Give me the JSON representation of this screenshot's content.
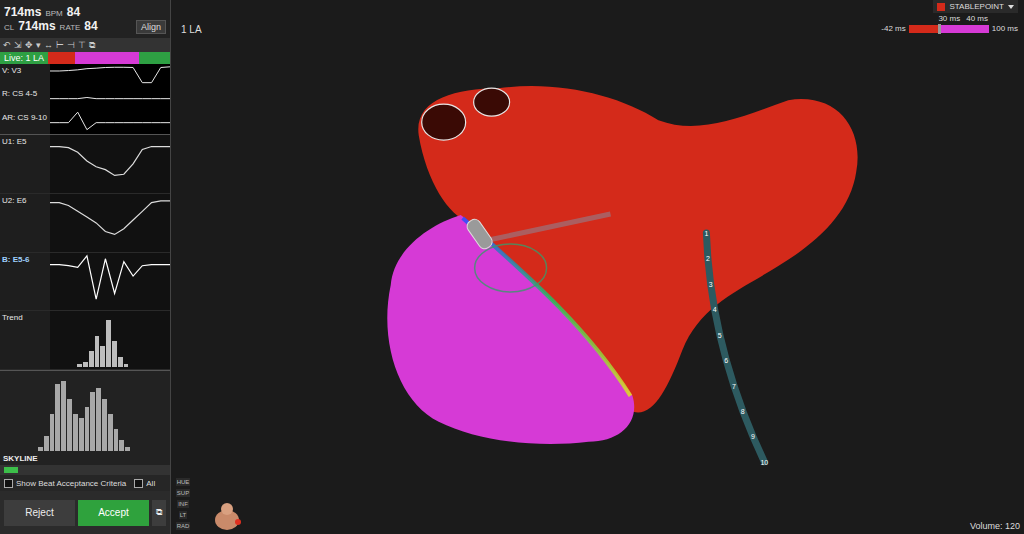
{
  "header": {
    "cl_top": "714ms",
    "bpm_label": "BPM",
    "bpm_top": "84",
    "cl_label": "CL",
    "cl": "714ms",
    "rate_label": "RATE",
    "rate": "84",
    "align": "Align"
  },
  "toolbar": [
    "↶",
    "⇲",
    "✥",
    "▾",
    "↔",
    "⊢",
    "⊣",
    "⊤",
    "⧉"
  ],
  "live": {
    "label": "Live: 1 LA",
    "segments": [
      {
        "color": "#2ea043",
        "level": 0.28
      },
      {
        "color": "#d42a1a",
        "level": 0.16
      },
      {
        "color": "#d63ad6",
        "level": 0.38
      },
      {
        "color": "#2ea043",
        "level": 0.18
      }
    ]
  },
  "reference": [
    {
      "label": "V: V3",
      "values": [
        0.7,
        0.7,
        0.72,
        0.75,
        0.8,
        0.82,
        0.85,
        0.86,
        0.86,
        0.85,
        0.2,
        0.2,
        0.85,
        0.88
      ]
    },
    {
      "label": "R: CS 4-5",
      "values": [
        0.5,
        0.5,
        0.5,
        0.5,
        0.55,
        0.5,
        0.5,
        0.5,
        0.5,
        0.5,
        0.5,
        0.5,
        0.5,
        0.5
      ]
    },
    {
      "label": "AR: CS 9-10",
      "values": [
        0.5,
        0.5,
        0.5,
        0.95,
        0.2,
        0.5,
        0.5,
        0.5,
        0.5,
        0.5,
        0.5,
        0.5,
        0.5,
        0.5
      ]
    }
  ],
  "electrodes": [
    {
      "label": "U1: E5",
      "kind": "trace",
      "selected": false,
      "values": [
        0.8,
        0.8,
        0.78,
        0.7,
        0.55,
        0.45,
        0.4,
        0.3,
        0.32,
        0.5,
        0.75,
        0.8,
        0.8,
        0.8
      ]
    },
    {
      "label": "U2: E6",
      "kind": "trace",
      "selected": false,
      "values": [
        0.85,
        0.85,
        0.8,
        0.7,
        0.6,
        0.5,
        0.35,
        0.3,
        0.4,
        0.55,
        0.7,
        0.85,
        0.88,
        0.88
      ]
    },
    {
      "label": "B: E5-6",
      "kind": "trace",
      "selected": true,
      "values": [
        0.8,
        0.8,
        0.78,
        0.75,
        0.95,
        0.2,
        0.9,
        0.3,
        0.85,
        0.6,
        0.78,
        0.8,
        0.8,
        0.8
      ]
    },
    {
      "label": "Trend",
      "kind": "bars",
      "selected": false,
      "values": [
        0,
        0,
        0,
        0.05,
        0.1,
        0.3,
        0.6,
        0.4,
        0.9,
        0.5,
        0.2,
        0.05,
        0,
        0
      ]
    }
  ],
  "skyline": {
    "label": "SKYLINE",
    "values": [
      0.05,
      0.2,
      0.5,
      0.9,
      0.95,
      0.7,
      0.5,
      0.45,
      0.6,
      0.8,
      0.85,
      0.7,
      0.5,
      0.3,
      0.15,
      0.05
    ]
  },
  "options": [
    {
      "label": "Show Beat Acceptance Criteria",
      "checked": false
    },
    {
      "label": "All",
      "checked": false
    }
  ],
  "buttons": [
    {
      "label": "Reject",
      "selected": false
    },
    {
      "label": "Accept",
      "selected": true
    },
    {
      "label": "⧉",
      "selected": false
    }
  ],
  "side_tools": [
    "HUE",
    "SUP",
    "INF",
    "LT",
    "RAD"
  ],
  "map": {
    "name": "1 LA",
    "setting": "STABLEPOINT",
    "legend": {
      "min": "-42 ms",
      "max": "100 ms",
      "ticks": [
        "30 ms",
        "40 ms"
      ],
      "segments": [
        {
          "color": "#d42a1a",
          "level": 0.36
        },
        {
          "color": "#d63ad6",
          "level": 0.64
        }
      ]
    },
    "volume": "Volume: 120",
    "cs_electrodes": [
      "1",
      "2",
      "3",
      "4",
      "5",
      "6",
      "7",
      "8",
      "9",
      "10"
    ]
  }
}
